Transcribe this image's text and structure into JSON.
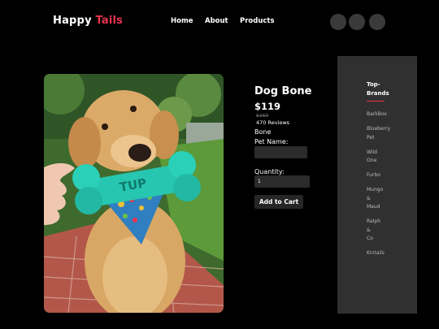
{
  "header": {
    "logo_part1": "Happy ",
    "logo_part2": "Tails",
    "nav": {
      "home": "Home",
      "about": "About",
      "products": "Products"
    },
    "accent_color": "#e8344e"
  },
  "product": {
    "image_icon": "dog-with-bone-photo",
    "name": "Dog Bone",
    "price": "$119",
    "old_price": "$160",
    "reviews": "470 Reviews",
    "variant": "Bone",
    "pet_name_label": "Pet Name:",
    "pet_name_value": "",
    "quantity_label": "Quantity:",
    "quantity_value": "1",
    "add_to_cart": "Add to Cart",
    "bone_text": "TUP"
  },
  "sidebar": {
    "title_line1": "Top-",
    "title_line2": "Brands",
    "brands": [
      {
        "l1": "BarkBox"
      },
      {
        "l1": "Blueberry",
        "l2": "Pet"
      },
      {
        "l1": "Wild",
        "l2": "One"
      },
      {
        "l1": "Furbo"
      },
      {
        "l1": "Mungo",
        "l2": "&",
        "l3": "Maud"
      },
      {
        "l1": "Ralph",
        "l2": "&",
        "l3": "Co"
      },
      {
        "l1": "Kintails"
      }
    ]
  }
}
